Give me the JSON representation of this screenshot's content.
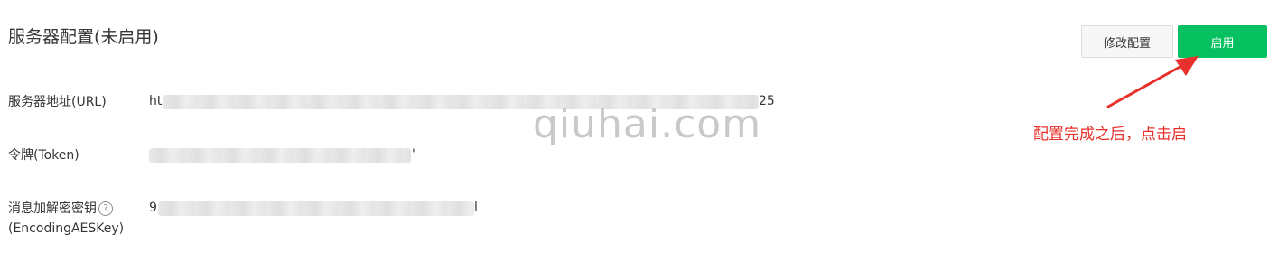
{
  "header": {
    "title": "服务器配置(未启用)",
    "edit_button": "修改配置",
    "enable_button": "启用"
  },
  "fields": {
    "url": {
      "label": "服务器地址(URL)",
      "value_start": "ht",
      "value_end": "25"
    },
    "token": {
      "label": "令牌(Token)",
      "value_end": "'"
    },
    "aes": {
      "label_line1": "消息加解密密钥",
      "label_line2": "(EncodingAESKey)",
      "help_glyph": "?",
      "value_start": "9",
      "value_end": "l"
    }
  },
  "watermark": "qiuhai.com",
  "annotation": {
    "text": "配置完成之后，点击启",
    "color": "#e8302c"
  },
  "colors": {
    "primary_green": "#07c160",
    "annotation_red": "#e8302c"
  },
  "icons": {
    "help": "question-circle-icon",
    "arrow": "red-annotation-arrow"
  }
}
